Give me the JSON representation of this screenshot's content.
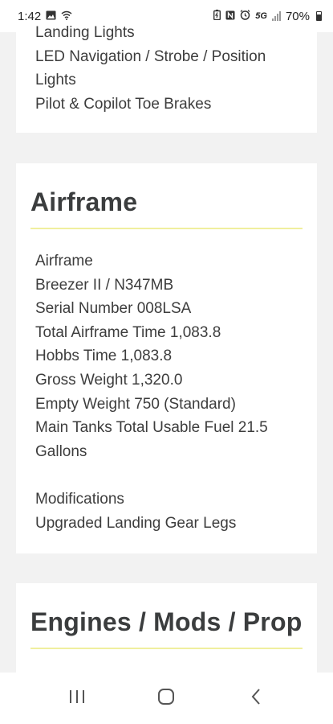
{
  "status_bar": {
    "time": "1:42",
    "network": "5G",
    "battery": "70%",
    "icons": [
      "image-icon",
      "wifi-icon",
      "battery-saver-icon",
      "nfc-icon",
      "alarm-icon",
      "signal-icon",
      "battery-icon"
    ]
  },
  "card_top": {
    "lines": [
      "Landing Lights",
      "LED Navigation / Strobe / Position",
      "Lights",
      "Pilot & Copilot Toe Brakes"
    ]
  },
  "airframe": {
    "title": "Airframe",
    "lines": [
      "Airframe",
      "Breezer II / N347MB",
      "Serial Number 008LSA",
      "Total Airframe Time 1,083.8",
      "Hobbs Time 1,083.8",
      "Gross Weight 1,320.0",
      "Empty Weight 750 (Standard)",
      "Main Tanks Total Usable Fuel 21.5",
      "Gallons",
      "",
      "Modifications",
      "Upgraded Landing Gear Legs"
    ]
  },
  "engines": {
    "title": "Engines / Mods / Prop"
  },
  "nav_bar": {
    "icons": [
      "recent-apps-icon",
      "home-icon",
      "back-icon"
    ]
  },
  "colors": {
    "accent_underline": "#f0ef9e",
    "page_bg": "#f2f2f2",
    "card_bg": "#ffffff",
    "text": "#3d3d3d"
  }
}
